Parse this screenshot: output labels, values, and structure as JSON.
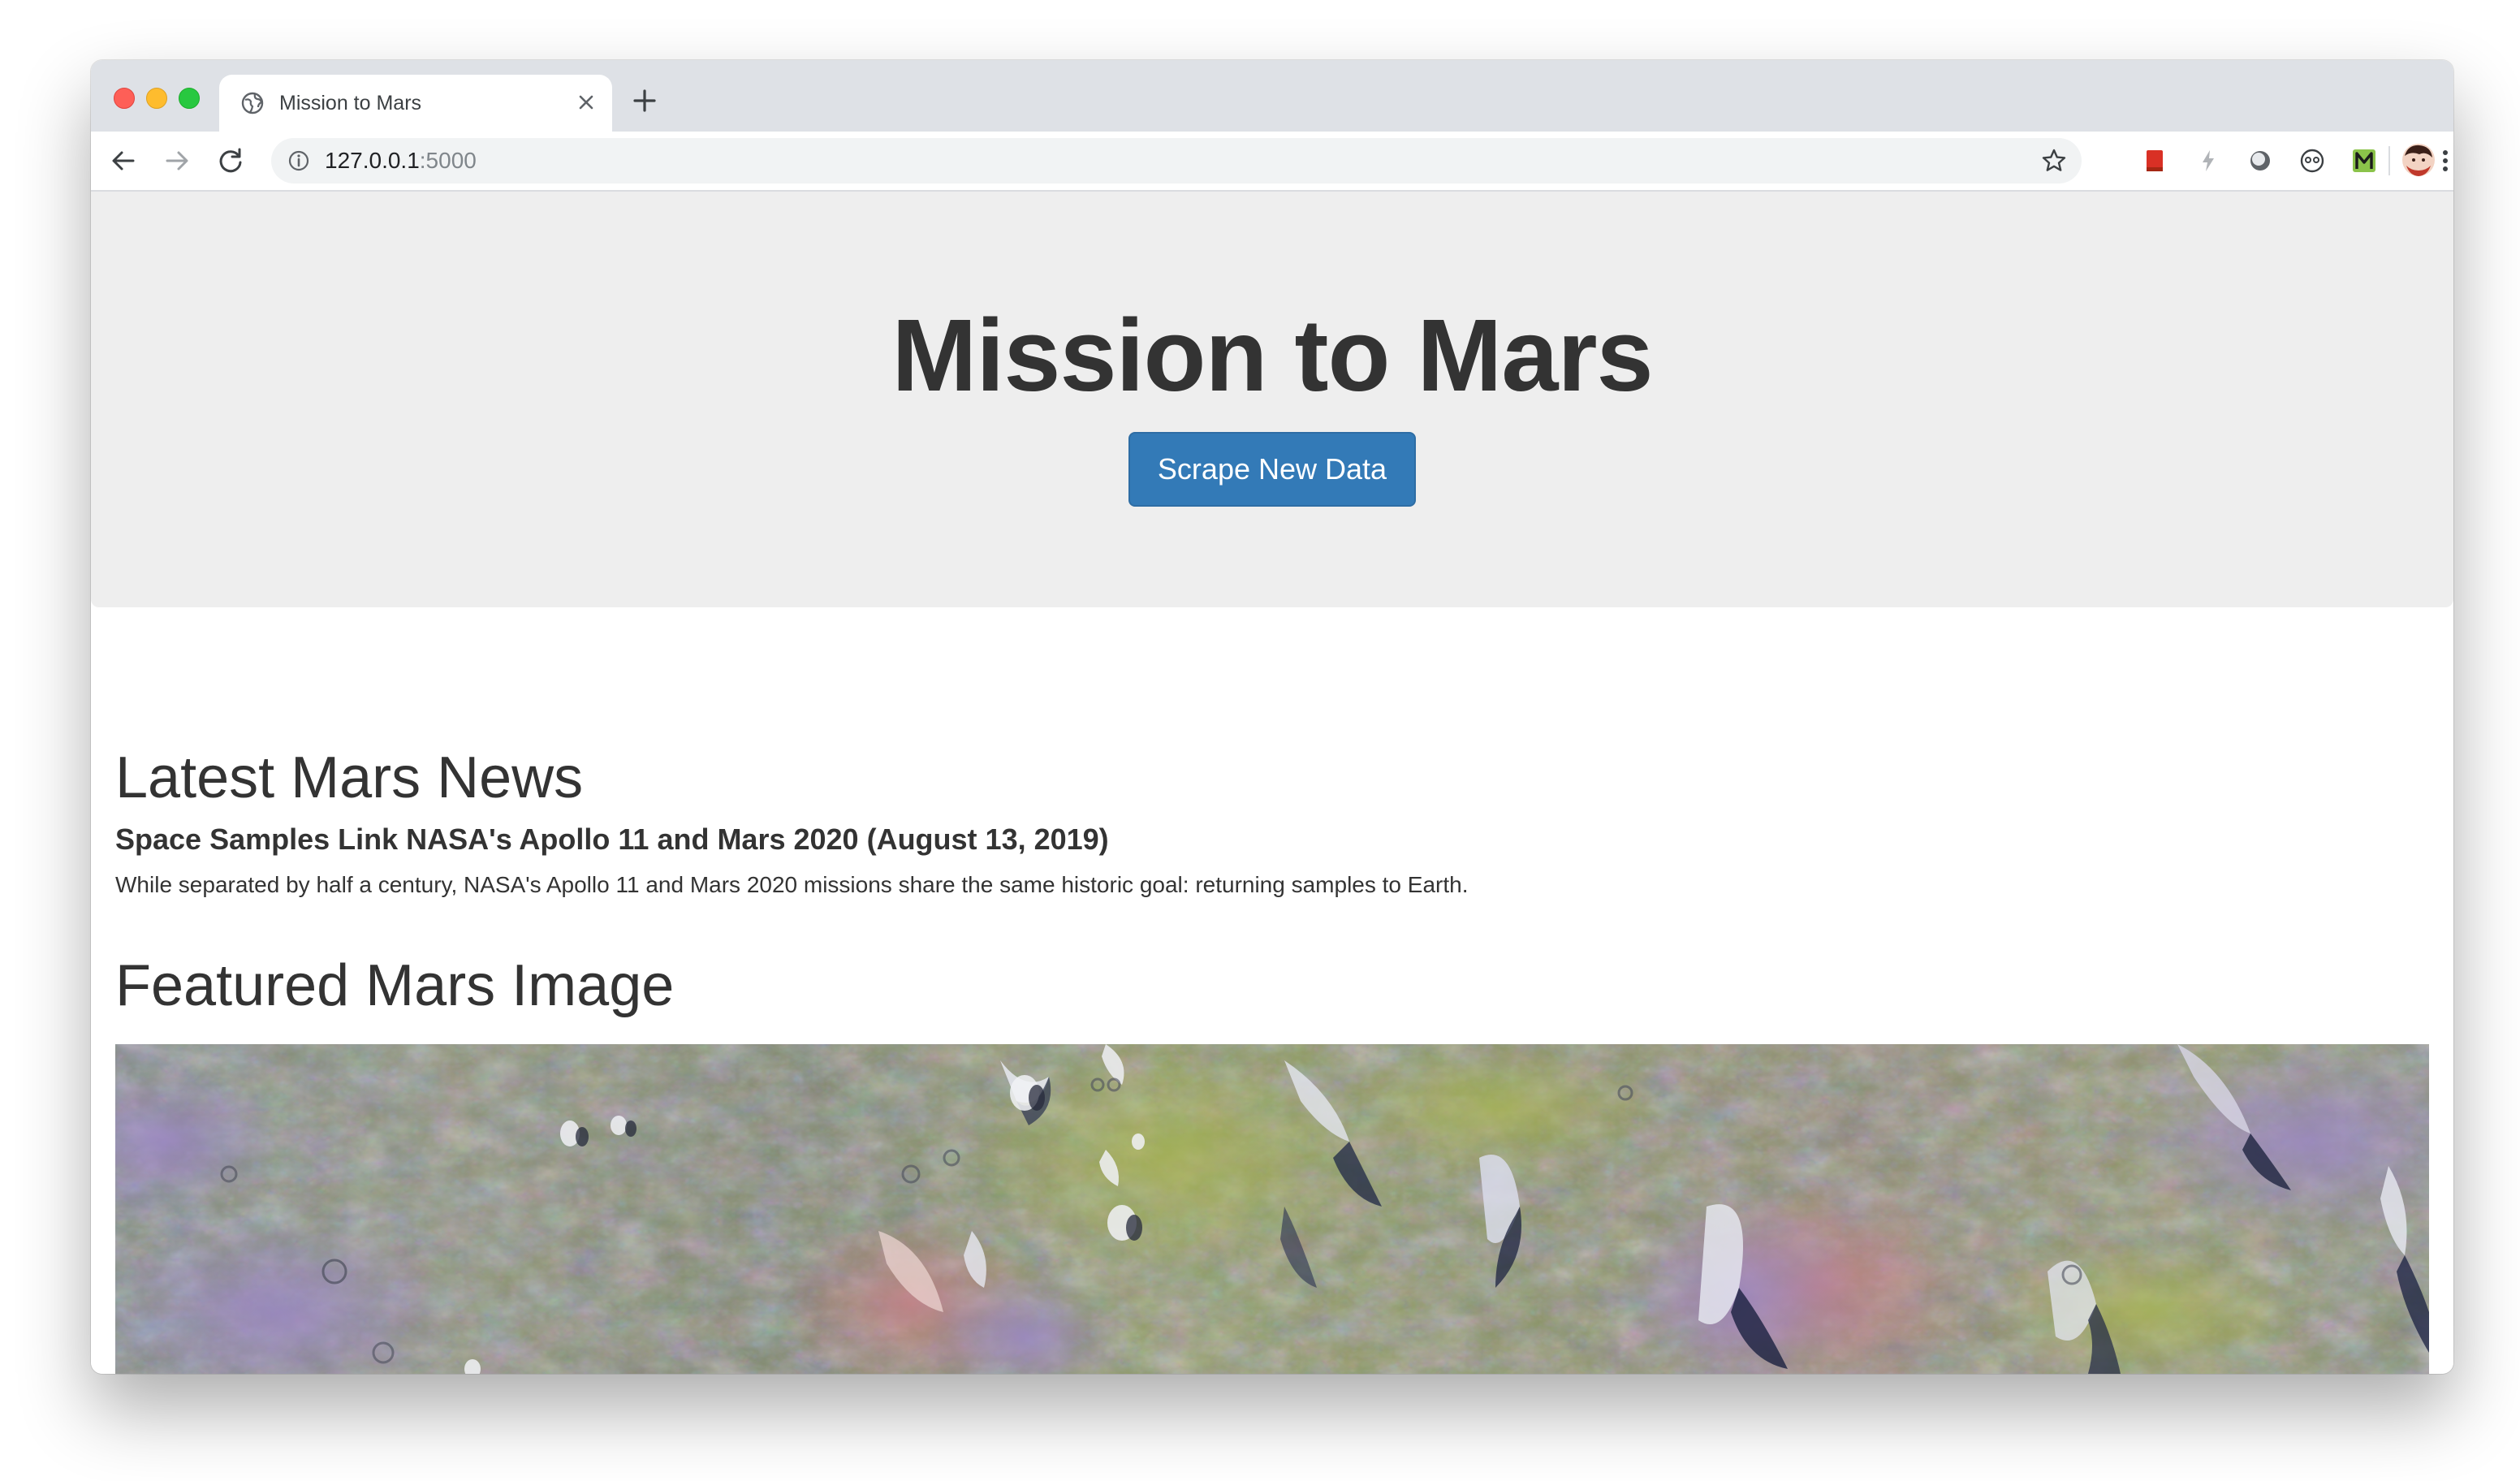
{
  "browser": {
    "tab": {
      "title": "Mission to Mars",
      "favicon": "globe-icon",
      "close_icon": "close-icon"
    },
    "new_tab_icon": "plus-icon",
    "nav": {
      "back_icon": "arrow-left-icon",
      "forward_icon": "arrow-right-icon",
      "reload_icon": "reload-icon"
    },
    "address": {
      "info_icon": "info-icon",
      "host": "127.0.0.1",
      "port": ":5000",
      "bookmark_icon": "star-icon"
    },
    "extensions": [
      "bookmark-ext-icon",
      "lightning-ext-icon",
      "circle-ext-icon",
      "mask-ext-icon",
      "m-ext-icon",
      "profile-avatar",
      "more-vert-icon"
    ]
  },
  "page": {
    "jumbotron": {
      "title": "Mission to Mars",
      "button_label": "Scrape New Data"
    },
    "news": {
      "heading": "Latest Mars News",
      "title": "Space Samples Link NASA's Apollo 11 and Mars 2020 (August 13, 2019)",
      "teaser": "While separated by half a century, NASA's Apollo 11 and Mars 2020 missions share the same historic goal: returning samples to Earth."
    },
    "featured": {
      "heading": "Featured Mars Image"
    }
  },
  "colors": {
    "jumbotron_bg": "#eeeeee",
    "button_primary": "#337ab7",
    "heading_text": "#333333",
    "tabstrip_bg": "#dee1e6"
  }
}
